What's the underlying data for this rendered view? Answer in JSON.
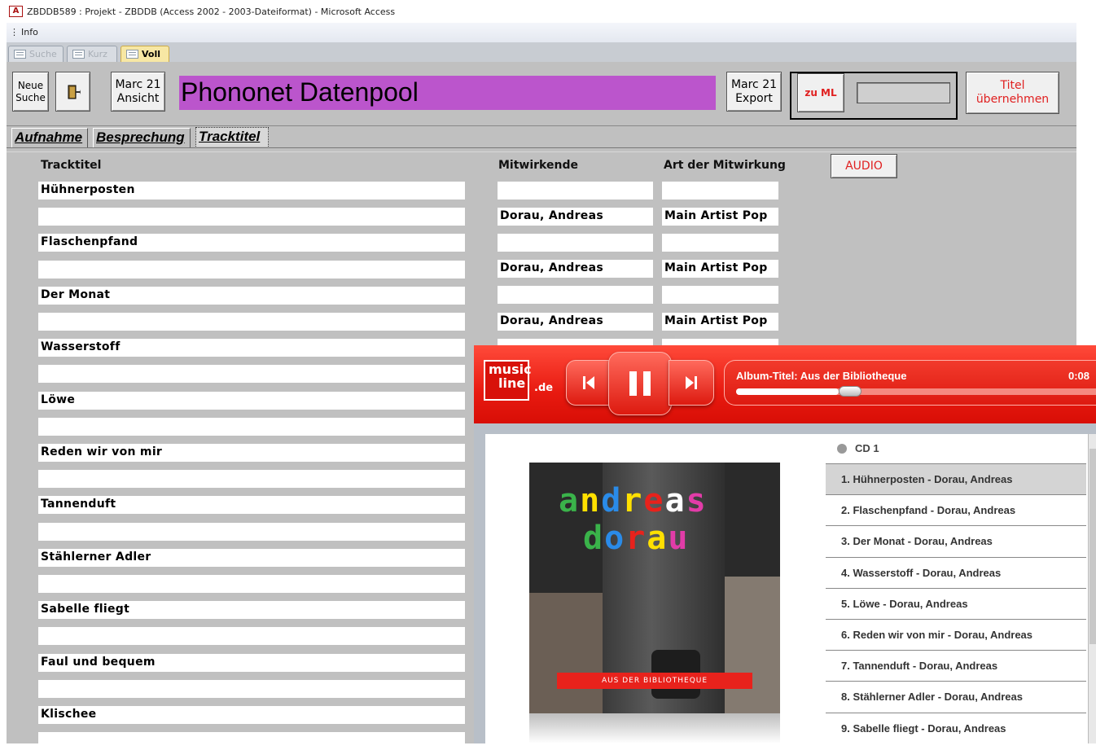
{
  "window": {
    "app_icon": "A",
    "title": "ZBDDB589 : Projekt - ZBDDB (Access 2002 - 2003-Dateiformat) - Microsoft Access"
  },
  "menu": {
    "grip": "⋮",
    "info": "Info"
  },
  "doc_tabs": [
    {
      "label": "Suche"
    },
    {
      "label": "Kurz"
    },
    {
      "label": "Voll"
    }
  ],
  "toolbar": {
    "new_search": "Neue Suche",
    "marc21_view": "Marc 21 Ansicht",
    "banner": "Phononet Datenpool",
    "marc21_export": "Marc 21 Export",
    "zu_ml": "zu ML",
    "titel_uebernehmen": "Titel übernehmen"
  },
  "subtabs": [
    "Aufnahme",
    "Besprechung",
    "Tracktitel"
  ],
  "columns": {
    "tracktitel": "Tracktitel",
    "mitwirkende": "Mitwirkende",
    "art": "Art der Mitwirkung",
    "audio": "AUDIO"
  },
  "track_rows": [
    {
      "title": "Hühnerposten",
      "blank": "",
      "mitwirkende": "Dorau, Andreas",
      "art": "Main Artist Pop"
    },
    {
      "title": "Flaschenpfand",
      "blank": "",
      "mitwirkende": "Dorau, Andreas",
      "art": "Main Artist Pop"
    },
    {
      "title": "Der Monat",
      "blank": "",
      "mitwirkende": "Dorau, Andreas",
      "art": "Main Artist Pop"
    },
    {
      "title": "Wasserstoff",
      "blank": ""
    },
    {
      "title": "Löwe",
      "blank": ""
    },
    {
      "title": "Reden wir von mir",
      "blank": ""
    },
    {
      "title": "Tannenduft",
      "blank": ""
    },
    {
      "title": "Stählerner Adler",
      "blank": ""
    },
    {
      "title": "Sabelle fliegt",
      "blank": ""
    },
    {
      "title": "Faul und bequem",
      "blank": ""
    },
    {
      "title": "Klischee",
      "blank": ""
    }
  ],
  "player": {
    "logo_top": "music",
    "logo_bottom": "line",
    "logo_domain": ".de",
    "album_label": "Album-Titel: Aus der Bibliotheque",
    "time": "0:08",
    "progress_fraction": 0.28,
    "cover_line1": "andreas",
    "cover_line2": "dorau",
    "cover_band": "AUS DER BIBLIOTHEQUE",
    "cd_label": "CD 1",
    "tracks": [
      "1. Hühnerposten - Dorau, Andreas",
      "2. Flaschenpfand - Dorau, Andreas",
      "3. Der Monat - Dorau, Andreas",
      "4. Wasserstoff - Dorau, Andreas",
      "5. Löwe - Dorau, Andreas",
      "6. Reden wir von mir - Dorau, Andreas",
      "7. Tannenduft - Dorau, Andreas",
      "8. Stählerner Adler - Dorau, Andreas",
      "9. Sabelle fliegt - Dorau, Andreas"
    ],
    "selected_track_index": 0
  },
  "colors": {
    "banner_bg": "#bb55cc",
    "form_bg": "#c0c0c0",
    "player_red": "#e81a10",
    "active_tab": "#f7e7a4"
  }
}
